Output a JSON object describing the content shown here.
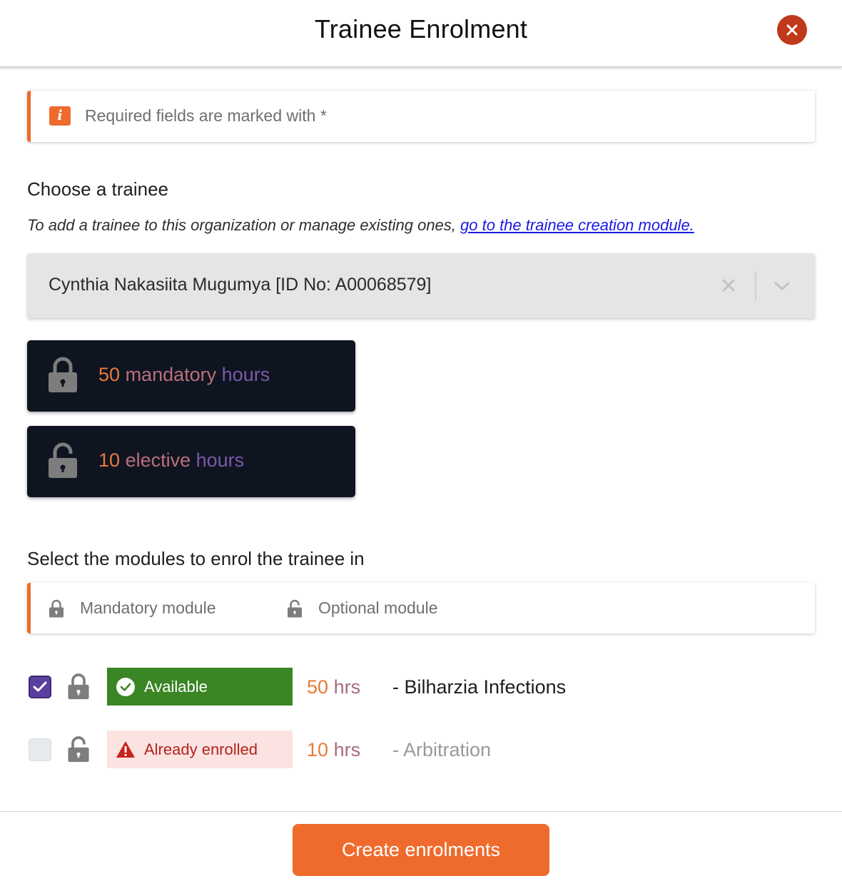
{
  "header": {
    "title": "Trainee Enrolment"
  },
  "notice": {
    "text": "Required fields are marked with *"
  },
  "trainee_section": {
    "title": "Choose a trainee",
    "hint": "To add a trainee to this organization or manage existing ones, ",
    "link": "go to the trainee creation module.",
    "selected": "Cynthia Nakasiita Mugumya [ID No: A00068579]"
  },
  "hours": {
    "mandatory": {
      "num": "50",
      "word1": "mandatory",
      "word2": "hours"
    },
    "elective": {
      "num": "10",
      "word1": "elective",
      "word2": "hours"
    }
  },
  "modules_section": {
    "title": "Select the modules to enrol the trainee in",
    "legend_mandatory": "Mandatory module",
    "legend_optional": "Optional module"
  },
  "modules": [
    {
      "status": "Available",
      "hrs": "50",
      "unit": "hrs",
      "name": "- Bilharzia Infections",
      "checked": true
    },
    {
      "status": "Already enrolled",
      "hrs": "10",
      "unit": "hrs",
      "name": "- Arbitration",
      "checked": false
    }
  ],
  "footer": {
    "button": "Create enrolments"
  },
  "colors": {
    "accent": "#ee6b2d",
    "close": "#c0391b",
    "card": "#0f1421",
    "success": "#3a8524",
    "danger_bg": "#fbe3e2",
    "check": "#5b3f9e"
  }
}
